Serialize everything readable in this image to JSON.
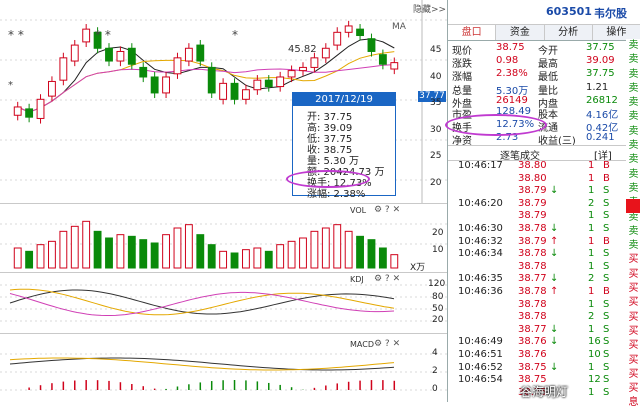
{
  "header": {
    "stock_code": "603501",
    "stock_name": "韦尔股",
    "hide_label": "隐藏>>"
  },
  "tabs": [
    "盘口",
    "资金",
    "分析",
    "操作"
  ],
  "quote": [
    {
      "l1": "现价",
      "v1": "38.75",
      "c1": "red",
      "l2": "今开",
      "v2": "37.75",
      "c2": "grn"
    },
    {
      "l1": "涨跌",
      "v1": "0.98",
      "c1": "red",
      "l2": "最高",
      "v2": "39.09",
      "c2": "red"
    },
    {
      "l1": "涨幅",
      "v1": "2.38%",
      "c1": "red",
      "l2": "最低",
      "v2": "37.75",
      "c2": "grn"
    },
    {
      "l1": "总量",
      "v1": "5.30万",
      "c1": "blu",
      "l2": "量比",
      "v2": "1.21",
      "c2": "blk"
    },
    {
      "l1": "外盘",
      "v1": "26149",
      "c1": "red",
      "l2": "内盘",
      "v2": "26812",
      "c2": "grn"
    }
  ],
  "quote2": [
    {
      "l1": "市盈",
      "v1": "128.49",
      "l2": "股本",
      "v2": "4.16亿"
    },
    {
      "l1": "换手",
      "v1": "12.73%",
      "l2": "流通",
      "v2": "0.42亿"
    },
    {
      "l1": "净资",
      "v1": "2.73",
      "l2": "收益(三)",
      "v2": "0.241"
    }
  ],
  "side_labels": [
    "卖",
    "卖",
    "卖",
    "卖",
    "卖",
    "卖",
    "卖",
    "卖",
    "卖",
    "卖",
    "卖",
    "卖",
    "卖",
    "卖",
    "卖",
    "买",
    "买",
    "买",
    "买",
    "买",
    "买",
    "买",
    "买",
    "买",
    "买",
    "息"
  ],
  "ticks_title": "逐笔成交",
  "ticks_badge": "[详]",
  "ticks": [
    {
      "time": "10:46:17",
      "price": "38.80",
      "dir": "",
      "qty": "1",
      "side": "B"
    },
    {
      "time": "",
      "price": "38.80",
      "dir": "",
      "qty": "1",
      "side": "B"
    },
    {
      "time": "",
      "price": "38.79",
      "dir": "↓",
      "qty": "1",
      "side": "S"
    },
    {
      "time": "10:46:20",
      "price": "38.79",
      "dir": "",
      "qty": "2",
      "side": "S"
    },
    {
      "time": "",
      "price": "38.79",
      "dir": "",
      "qty": "1",
      "side": "S"
    },
    {
      "time": "10:46:30",
      "price": "38.78",
      "dir": "↓",
      "qty": "1",
      "side": "S"
    },
    {
      "time": "10:46:32",
      "price": "38.79",
      "dir": "↑",
      "qty": "1",
      "side": "B"
    },
    {
      "time": "10:46:34",
      "price": "38.78",
      "dir": "↓",
      "qty": "1",
      "side": "S"
    },
    {
      "time": "",
      "price": "38.78",
      "dir": "",
      "qty": "1",
      "side": "S"
    },
    {
      "time": "10:46:35",
      "price": "38.77",
      "dir": "↓",
      "qty": "2",
      "side": "S"
    },
    {
      "time": "10:46:36",
      "price": "38.78",
      "dir": "↑",
      "qty": "1",
      "side": "B"
    },
    {
      "time": "",
      "price": "38.78",
      "dir": "",
      "qty": "1",
      "side": "S"
    },
    {
      "time": "",
      "price": "38.78",
      "dir": "",
      "qty": "2",
      "side": "S"
    },
    {
      "time": "",
      "price": "38.77",
      "dir": "↓",
      "qty": "1",
      "side": "S"
    },
    {
      "time": "10:46:49",
      "price": "38.76",
      "dir": "↓",
      "qty": "16",
      "side": "S"
    },
    {
      "time": "10:46:51",
      "price": "38.76",
      "dir": "",
      "qty": "10",
      "side": "S"
    },
    {
      "time": "10:46:52",
      "price": "38.75",
      "dir": "↓",
      "qty": "1",
      "side": "S"
    },
    {
      "time": "10:46:54",
      "price": "38.75",
      "dir": "",
      "qty": "12",
      "side": "S"
    },
    {
      "time": "",
      "price": "38.75",
      "dir": "",
      "qty": "1",
      "side": "S"
    }
  ],
  "tooltip": {
    "date": "2017/12/19",
    "lines": [
      "开: 37.75",
      "高: 39.09",
      "低: 37.75",
      "收: 38.75",
      "量: 5.30 万",
      "额: 20424.73 万",
      "换手: 12.73%",
      "涨幅: 2.38%"
    ]
  },
  "main_axis": [
    "45",
    "40",
    "35",
    "30",
    "25",
    "20"
  ],
  "price_tag": "37.77",
  "high_label": "45.82",
  "pane_labels": {
    "ma": "MA",
    "vol": "VOL",
    "kdj": "KDJ",
    "macd": "MACD",
    "vol_unit": "X万"
  },
  "vol_axis": [
    "20",
    "10"
  ],
  "kdj_axis": [
    "120",
    "80",
    "50",
    "20",
    "-20"
  ],
  "macd_axis": [
    "4",
    "2",
    "0"
  ],
  "markers": "* *",
  "watermark": "谷海明灯",
  "colors": {
    "up": "#d0021b",
    "down": "#0a8a0a",
    "tooltip": "#1a66c4",
    "highlight": "#c03ad0"
  },
  "chart_data": {
    "type": "candlestick",
    "candles": [
      {
        "o": 30.5,
        "c": 31.8
      },
      {
        "o": 31.5,
        "c": 30.2
      },
      {
        "o": 30.0,
        "c": 33.0
      },
      {
        "o": 33.5,
        "c": 35.8
      },
      {
        "o": 36.0,
        "c": 39.5
      },
      {
        "o": 39.0,
        "c": 41.5
      },
      {
        "o": 42.0,
        "c": 44.0
      },
      {
        "o": 43.5,
        "c": 41.0
      },
      {
        "o": 41.0,
        "c": 39.0
      },
      {
        "o": 39.0,
        "c": 40.5
      },
      {
        "o": 41.0,
        "c": 38.5
      },
      {
        "o": 38.0,
        "c": 36.5
      },
      {
        "o": 36.5,
        "c": 34.0
      },
      {
        "o": 34.0,
        "c": 36.5
      },
      {
        "o": 37.0,
        "c": 39.5
      },
      {
        "o": 39.0,
        "c": 41.0
      },
      {
        "o": 41.5,
        "c": 39.0
      },
      {
        "o": 38.0,
        "c": 34.0
      },
      {
        "o": 33.0,
        "c": 35.5
      },
      {
        "o": 35.5,
        "c": 33.0
      },
      {
        "o": 33.0,
        "c": 34.5
      },
      {
        "o": 34.5,
        "c": 36.0
      },
      {
        "o": 36.0,
        "c": 35.0
      },
      {
        "o": 35.0,
        "c": 36.5
      },
      {
        "o": 36.5,
        "c": 37.5
      },
      {
        "o": 37.5,
        "c": 38.0
      },
      {
        "o": 38.0,
        "c": 39.5
      },
      {
        "o": 39.5,
        "c": 41.0
      },
      {
        "o": 41.5,
        "c": 43.5
      },
      {
        "o": 43.5,
        "c": 44.5
      },
      {
        "o": 44.0,
        "c": 43.0
      },
      {
        "o": 42.5,
        "c": 40.5
      },
      {
        "o": 40.0,
        "c": 38.5
      },
      {
        "o": 37.75,
        "c": 38.75
      }
    ],
    "volume": [
      12,
      10,
      14,
      16,
      22,
      25,
      28,
      22,
      18,
      20,
      19,
      17,
      15,
      20,
      24,
      26,
      20,
      14,
      10,
      9,
      11,
      12,
      10,
      14,
      16,
      18,
      22,
      24,
      26,
      22,
      19,
      17,
      12,
      8
    ],
    "y_range": [
      18,
      47
    ]
  }
}
